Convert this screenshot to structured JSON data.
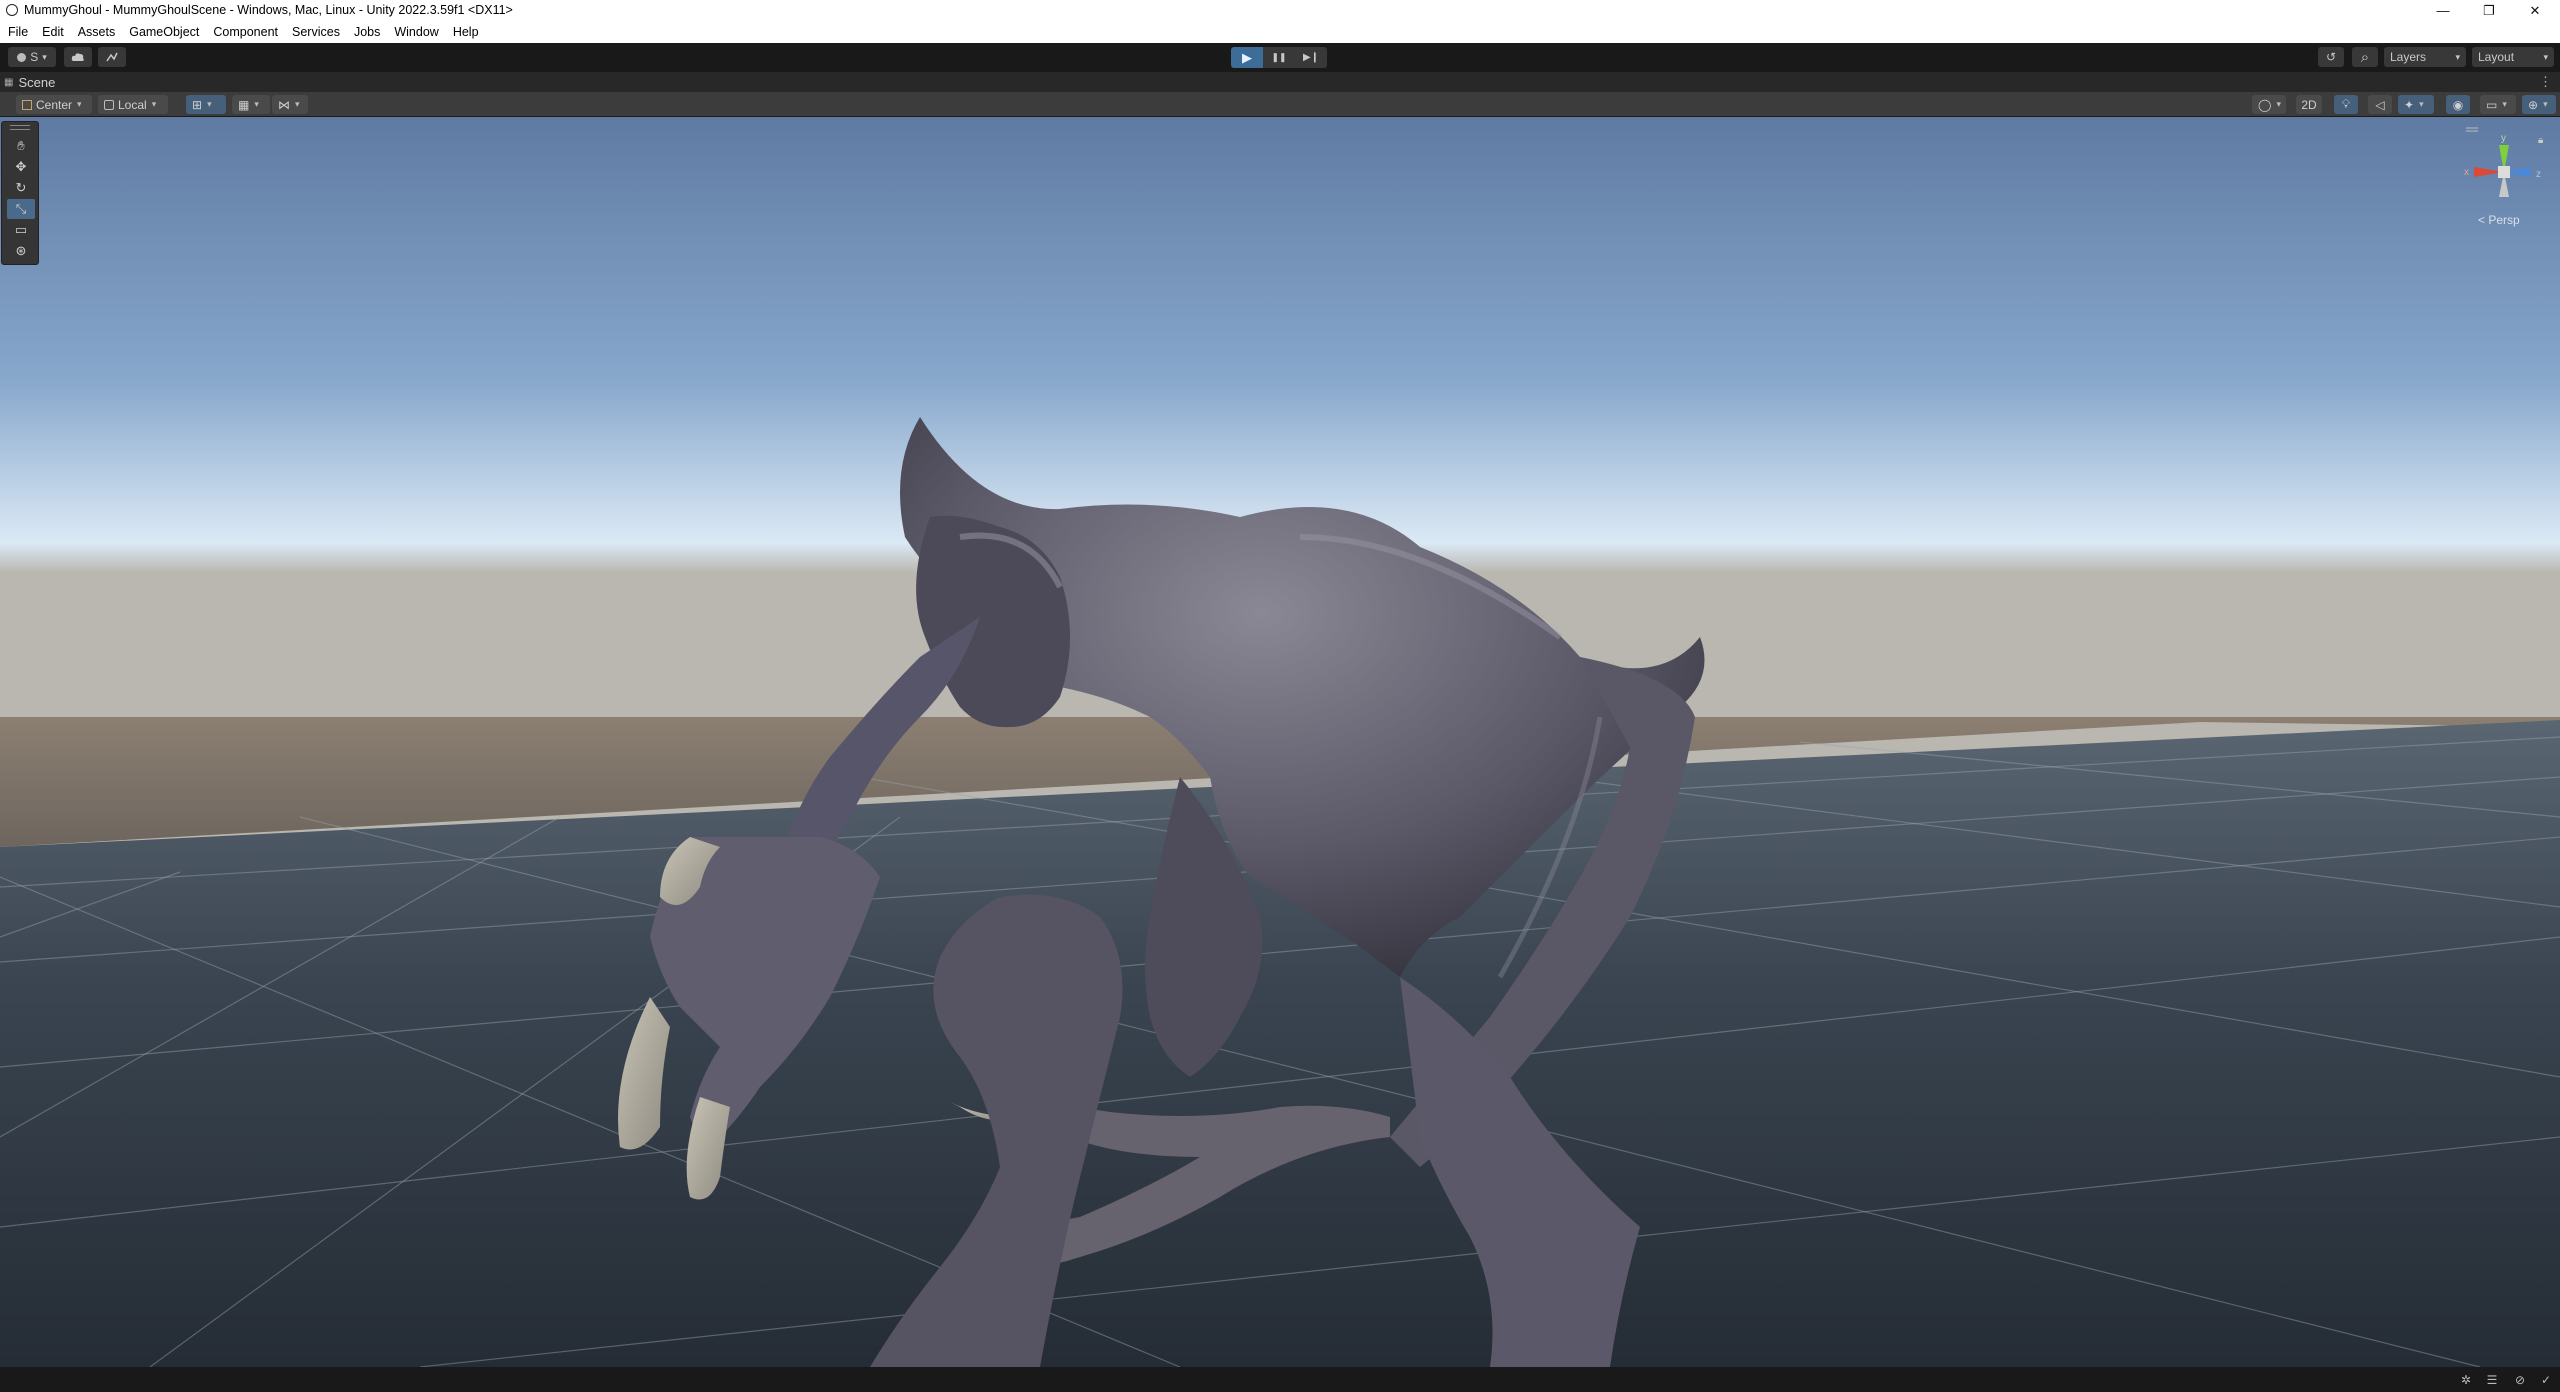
{
  "window": {
    "title": "MummyGhoul - MummyGhoulScene - Windows, Mac, Linux - Unity 2022.3.59f1 <DX11>",
    "minimize": "—",
    "maximize": "❐",
    "close": "✕"
  },
  "menu": [
    "File",
    "Edit",
    "Assets",
    "GameObject",
    "Component",
    "Services",
    "Jobs",
    "Window",
    "Help"
  ],
  "toolbar": {
    "account_label": "S",
    "cloud_icon": "cloud-icon",
    "collab_icon": "branch-icon",
    "play_icon": "▶",
    "pause_icon": "❚❚",
    "step_icon": "▶❙",
    "history_icon": "↺",
    "search_icon": "⌕",
    "layers_label": "Layers",
    "layout_label": "Layout",
    "play_active_color": "#3e6c98"
  },
  "scene_tab": {
    "label": "Scene",
    "menu": "⋮"
  },
  "scene_toolbar": {
    "pivot_label": "Center",
    "space_label": "Local",
    "mode_2d": "2D",
    "caret": "▾"
  },
  "tools": [
    "hand-tool",
    "move-tool",
    "rotate-tool",
    "scale-tool",
    "rect-tool",
    "transform-tool"
  ],
  "gizmo": {
    "y_label": "y",
    "x_label": "x",
    "z_label": "z",
    "projection": "< Persp"
  },
  "colors": {
    "sky_top": "#5f7aa3",
    "sky_horizon": "#dbe9f5",
    "ground": "#313b46",
    "creature": "#5a5866"
  }
}
